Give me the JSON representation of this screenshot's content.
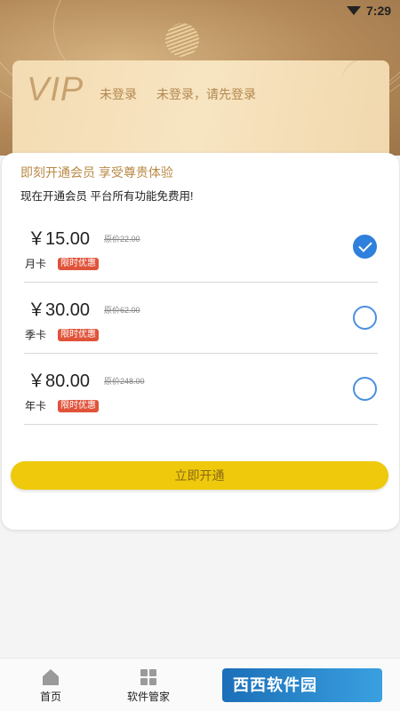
{
  "status": {
    "time": "7:29"
  },
  "card": {
    "vip": "VIP",
    "login_status": "未登录",
    "login_prompt": "未登录，请先登录"
  },
  "panel": {
    "title": "即刻开通会员 享受尊贵体验",
    "subtitle": "现在开通会员 平台所有功能免费用!",
    "plans": [
      {
        "price": "￥15.00",
        "original": "原价22.00",
        "name": "月卡",
        "badge": "限时优惠",
        "selected": true
      },
      {
        "price": "￥30.00",
        "original": "原价62.00",
        "name": "季卡",
        "badge": "限时优惠",
        "selected": false
      },
      {
        "price": "￥80.00",
        "original": "原价248.00",
        "name": "年卡",
        "badge": "限时优惠",
        "selected": false
      }
    ],
    "button": "立即开通"
  },
  "tabs": [
    {
      "label": "首页",
      "icon": "home-icon"
    },
    {
      "label": "软件管家",
      "icon": "grid-icon"
    }
  ],
  "watermark": "西西软件园"
}
